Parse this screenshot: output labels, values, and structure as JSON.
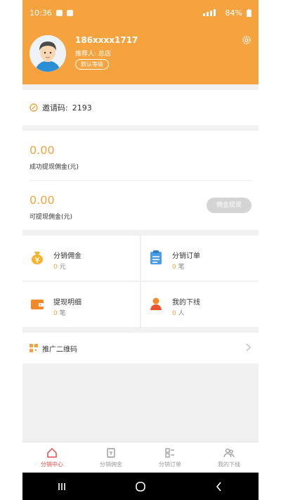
{
  "status_bar": {
    "time": "10:36",
    "battery": "84%"
  },
  "profile": {
    "phone": "186xxxx1717",
    "referrer": "推荐人: 总店",
    "level": "默认等级"
  },
  "invite": {
    "label": "邀请码:",
    "code": "2193"
  },
  "stats": {
    "success_value": "0.00",
    "success_label": "成功提现佣金(元)",
    "available_value": "0.00",
    "available_label": "可提现佣金(元)",
    "withdraw_button": "佣金提现"
  },
  "grid": [
    {
      "title": "分销佣金",
      "count": "0",
      "unit": "元",
      "icon": "money-bag-icon"
    },
    {
      "title": "分销订单",
      "count": "0",
      "unit": "笔",
      "icon": "clipboard-icon"
    },
    {
      "title": "提现明细",
      "count": "0",
      "unit": "笔",
      "icon": "wallet-icon"
    },
    {
      "title": "我的下线",
      "count": "0",
      "unit": "人",
      "icon": "user-icon"
    }
  ],
  "promo": {
    "label": "推广二维码"
  },
  "tabs": [
    {
      "label": "分销中心",
      "active": true
    },
    {
      "label": "分销佣金",
      "active": false
    },
    {
      "label": "分销订单",
      "active": false
    },
    {
      "label": "我的下线",
      "active": false
    }
  ],
  "colors": {
    "accent": "#f5a33f",
    "tab_active": "#e04b4b"
  }
}
